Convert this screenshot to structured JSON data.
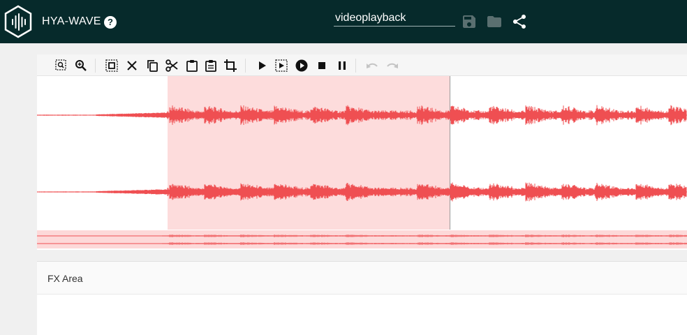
{
  "header": {
    "app_title": "HYA-WAVE",
    "help_glyph": "?",
    "filename": "videoplayback",
    "icons": [
      "logo-waveform-icon",
      "help-icon",
      "save-icon",
      "folder-icon",
      "share-icon"
    ]
  },
  "toolbar": {
    "buttons": [
      "zoom-selection-icon",
      "zoom-icon",
      "select-all-icon",
      "clear-icon",
      "copy-icon",
      "cut-icon",
      "paste-icon",
      "paste-special-icon",
      "crop-icon",
      "play-icon",
      "play-selection-icon",
      "record-icon",
      "stop-icon",
      "pause-icon",
      "undo-icon",
      "redo-icon"
    ]
  },
  "waveform": {
    "wave_color": "#ef4f52",
    "selection_color": "#fddcdc",
    "channels": 2,
    "selection_fraction": [
      0.2,
      0.635
    ]
  },
  "fx": {
    "title": "FX Area"
  },
  "colors": {
    "header_bg": "#062a2b",
    "panel_bg": "#f0f0f0"
  }
}
